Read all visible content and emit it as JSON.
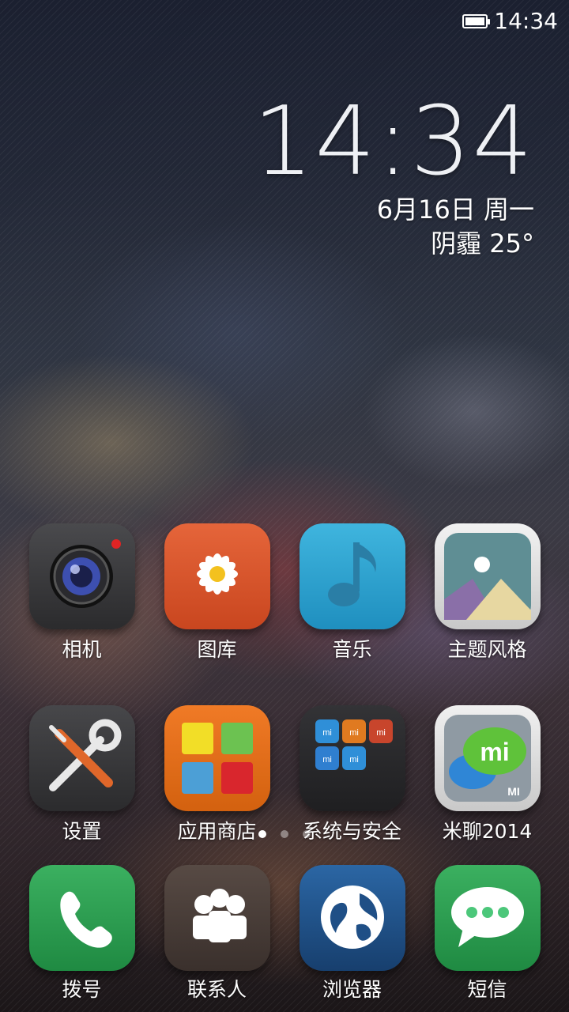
{
  "status_bar": {
    "time": "14:34",
    "battery_icon": "battery-icon"
  },
  "widget": {
    "time": "14:34",
    "date": "6月16日 周一",
    "weather": "阴霾  25°"
  },
  "apps": [
    {
      "label": "相机",
      "icon": "camera-icon"
    },
    {
      "label": "图库",
      "icon": "gallery-flower-icon"
    },
    {
      "label": "音乐",
      "icon": "music-note-icon"
    },
    {
      "label": "主题风格",
      "icon": "theme-picture-icon"
    },
    {
      "label": "设置",
      "icon": "settings-tools-icon"
    },
    {
      "label": "应用商店",
      "icon": "app-store-icon"
    },
    {
      "label": "系统与安全",
      "icon": "folder-icon"
    },
    {
      "label": "米聊2014",
      "icon": "miliao-chat-icon"
    }
  ],
  "folder_mini_icon_text": [
    "mi",
    "mi",
    "mi",
    "mi",
    "mi"
  ],
  "miliao_icon_text": {
    "main": "mi",
    "corner": "MI"
  },
  "page_indicator": {
    "total": 3,
    "current": 1
  },
  "dock": [
    {
      "label": "拨号",
      "icon": "phone-icon"
    },
    {
      "label": "联系人",
      "icon": "contacts-icon"
    },
    {
      "label": "浏览器",
      "icon": "browser-globe-icon"
    },
    {
      "label": "短信",
      "icon": "sms-bubble-icon"
    }
  ],
  "colors": {
    "camera": "#3a3a3c",
    "gallery": "#d9532c",
    "music": "#2fa6d1",
    "theme": "#d9d9d9",
    "settings": "#3a3a3c",
    "store": "#e0701c",
    "folder": "#2a2a2c",
    "miliao": "#d8d8d8",
    "phone": "#2e9e4f",
    "contacts": "#4a3f3a",
    "browser": "#1f4f86",
    "sms": "#2e9e4f"
  }
}
